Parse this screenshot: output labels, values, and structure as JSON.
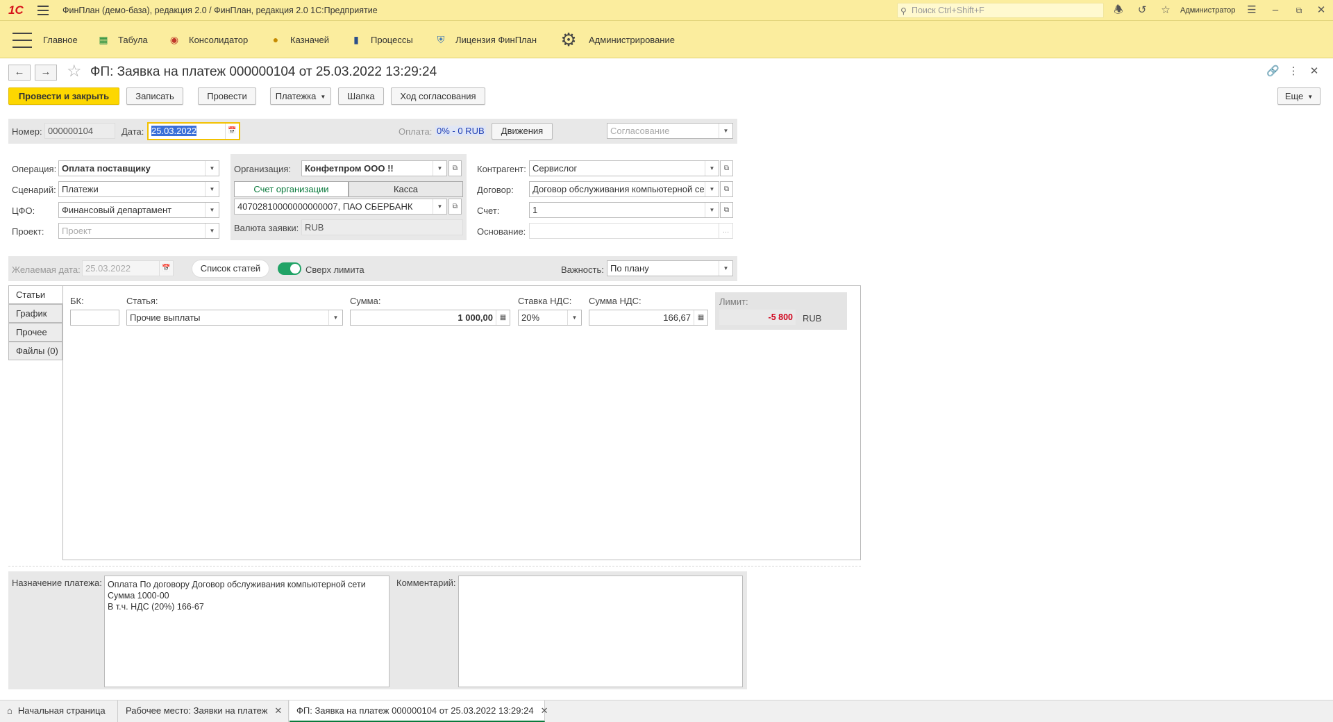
{
  "titlebar": {
    "logo": "1С",
    "app_title": "ФинПлан (демо-база), редакция 2.0 / ФинПлан, редакция 2.0 1С:Предприятие",
    "search_placeholder": "Поиск Ctrl+Shift+F",
    "user": "Администратор"
  },
  "sections": [
    {
      "label": "Главное",
      "icon": "burger-menu-icon"
    },
    {
      "label": "Табула",
      "icon": "tabula-grid-icon"
    },
    {
      "label": "Консолидатор",
      "icon": "consolidator-icon"
    },
    {
      "label": "Казначей",
      "icon": "treasurer-icon"
    },
    {
      "label": "Процессы",
      "icon": "processes-bars-icon"
    },
    {
      "label": "Лицензия ФинПлан",
      "icon": "license-shield-icon"
    },
    {
      "label": "Администрирование",
      "icon": "gear-icon"
    }
  ],
  "form": {
    "title": "ФП: Заявка на платеж 000000104 от 25.03.2022 13:29:24",
    "buttons": {
      "post_close": "Провести и закрыть",
      "save": "Записать",
      "post": "Провести",
      "payment": "Платежка",
      "header": "Шапка",
      "approval_progress": "Ход согласования",
      "more": "Еще"
    },
    "header": {
      "number_label": "Номер:",
      "number": "000000104",
      "date_label": "Дата:",
      "date": "25.03.2022",
      "payment_label": "Оплата:",
      "payment_value": "0% - 0 RUB",
      "movements": "Движения",
      "approval_placeholder": "Согласование"
    },
    "left": {
      "operation_label": "Операция:",
      "operation": "Оплата поставщику",
      "scenario_label": "Сценарий:",
      "scenario": "Платежи",
      "cfo_label": "ЦФО:",
      "cfo": "Финансовый департамент",
      "project_label": "Проект:",
      "project_placeholder": "Проект"
    },
    "middle": {
      "org_label": "Организация:",
      "org": "Конфетпром ООО  !!",
      "tab_account": "Счет организации",
      "tab_cash": "Касса",
      "account": "40702810000000000007, ПАО СБЕРБАНК",
      "currency_label": "Валюта заявки:",
      "currency": "RUB"
    },
    "right": {
      "counterparty_label": "Контрагент:",
      "counterparty": "Сервислог",
      "contract_label": "Договор:",
      "contract": "Договор обслуживания компьютерной се",
      "invoice_label": "Счет:",
      "invoice": "1",
      "basis_label": "Основание:",
      "basis": ""
    },
    "row2": {
      "desired_date_label": "Желаемая дата:",
      "desired_date": "25.03.2022",
      "items_list": "Список статей",
      "over_limit": "Сверх лимита",
      "over_limit_on": true,
      "importance_label": "Важность:",
      "importance": "По плану"
    },
    "tabs": [
      "Статьи",
      "График",
      "Прочее",
      "Файлы (0)"
    ],
    "items": {
      "bk_label": "БК:",
      "bk": "",
      "item_label": "Статья:",
      "item": "Прочие выплаты",
      "sum_label": "Сумма:",
      "sum": "1 000,00",
      "vat_rate_label": "Ставка НДС:",
      "vat_rate": "20%",
      "vat_sum_label": "Сумма НДС:",
      "vat_sum": "166,67",
      "limit_label": "Лимит:",
      "limit": "-5 800",
      "limit_currency": "RUB",
      "limit_color": "#d0021b"
    },
    "bottom": {
      "purpose_label": "Назначение платежа:",
      "purpose_lines": [
        "Оплата По договору Договор обслуживания компьютерной сети",
        "Сумма 1000-00",
        "В т.ч. НДС  (20%) 166-67"
      ],
      "comment_label": "Комментарий:",
      "comment": ""
    }
  },
  "open_tabs": [
    {
      "label": "Начальная страница",
      "active": false
    },
    {
      "label": "Рабочее место: Заявки на платеж",
      "active": false
    },
    {
      "label": "ФП: Заявка на платеж 000000104 от 25.03.2022 13:29:24",
      "active": true
    }
  ],
  "colors": {
    "accent_yellow": "#fdd700",
    "panel_yellow": "#fbed9e",
    "accent_green": "#21a366"
  }
}
